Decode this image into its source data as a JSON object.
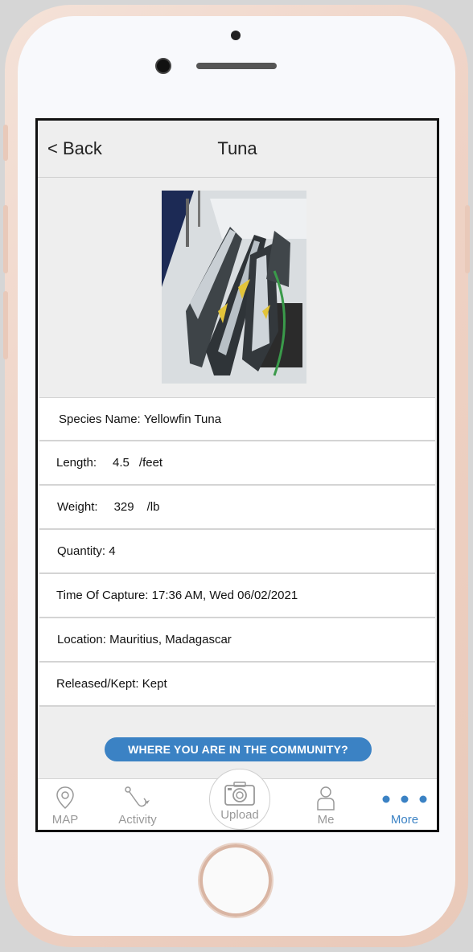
{
  "header": {
    "back_label": "< Back",
    "title": "Tuna"
  },
  "photo": {
    "alt": "yellowfin-tuna-catch-photo"
  },
  "details": {
    "species_label": "Species Name:",
    "species_value": "Yellowfin Tuna",
    "length_label": "Length:",
    "length_value": "4.5",
    "length_unit": "/feet",
    "weight_label": "Weight:",
    "weight_value": "329",
    "weight_unit": "/lb",
    "quantity_label": "Quantity:",
    "quantity_value": "4",
    "time_label": "Time Of Capture:",
    "time_value": "17:36 AM, Wed 06/02/2021",
    "location_label": "Location:",
    "location_value": "Mauritius, Madagascar",
    "released_label": "Released/Kept:",
    "released_value": "Kept"
  },
  "community_button": "WHERE YOU ARE IN THE COMMUNITY?",
  "tabs": {
    "map": "MAP",
    "activity": "Activity",
    "upload": "Upload",
    "me": "Me",
    "more": "More"
  },
  "colors": {
    "accent": "#3b82c4",
    "inactive": "#999999"
  }
}
